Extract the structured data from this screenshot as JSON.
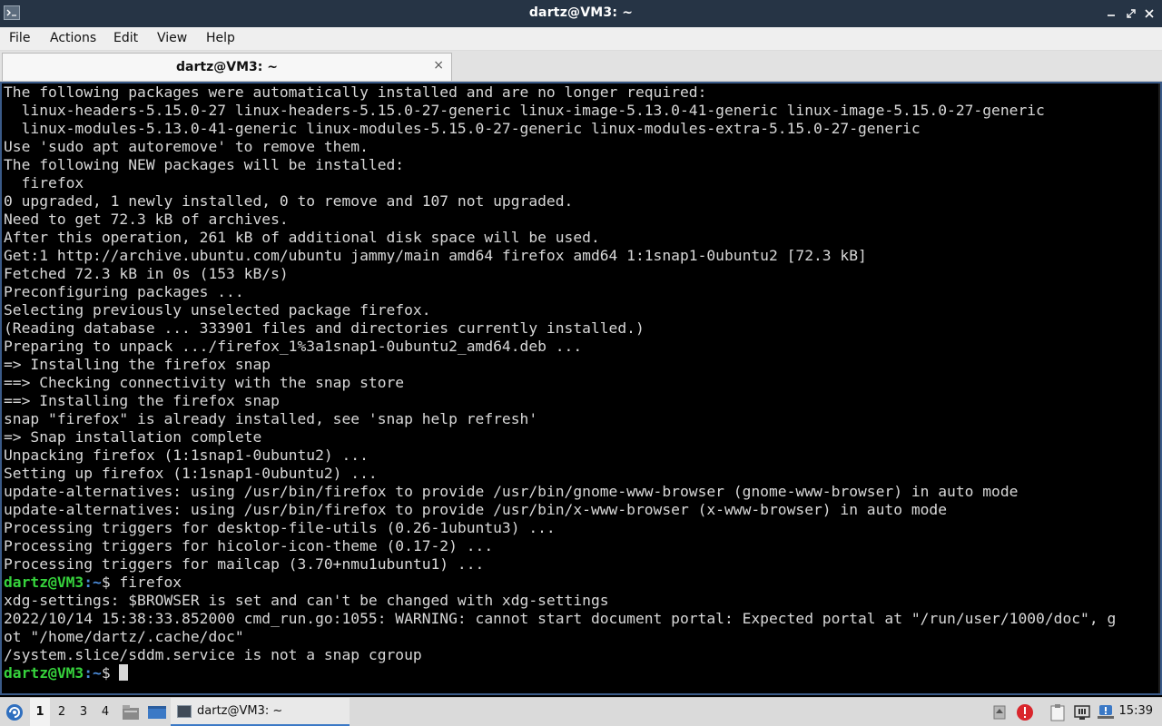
{
  "window": {
    "title": "dartz@VM3: ~"
  },
  "menu": [
    "File",
    "Actions",
    "Edit",
    "View",
    "Help"
  ],
  "tab": {
    "label": "dartz@VM3: ~",
    "close_glyph": "×"
  },
  "terminal": {
    "lines": [
      "The following packages were automatically installed and are no longer required:",
      "  linux-headers-5.15.0-27 linux-headers-5.15.0-27-generic linux-image-5.13.0-41-generic linux-image-5.15.0-27-generic",
      "  linux-modules-5.13.0-41-generic linux-modules-5.15.0-27-generic linux-modules-extra-5.15.0-27-generic",
      "Use 'sudo apt autoremove' to remove them.",
      "The following NEW packages will be installed:",
      "  firefox",
      "0 upgraded, 1 newly installed, 0 to remove and 107 not upgraded.",
      "Need to get 72.3 kB of archives.",
      "After this operation, 261 kB of additional disk space will be used.",
      "Get:1 http://archive.ubuntu.com/ubuntu jammy/main amd64 firefox amd64 1:1snap1-0ubuntu2 [72.3 kB]",
      "Fetched 72.3 kB in 0s (153 kB/s)",
      "Preconfiguring packages ...",
      "Selecting previously unselected package firefox.",
      "(Reading database ... 333901 files and directories currently installed.)",
      "Preparing to unpack .../firefox_1%3a1snap1-0ubuntu2_amd64.deb ...",
      "=> Installing the firefox snap",
      "==> Checking connectivity with the snap store",
      "==> Installing the firefox snap",
      "snap \"firefox\" is already installed, see 'snap help refresh'",
      "=> Snap installation complete",
      "Unpacking firefox (1:1snap1-0ubuntu2) ...",
      "Setting up firefox (1:1snap1-0ubuntu2) ...",
      "update-alternatives: using /usr/bin/firefox to provide /usr/bin/gnome-www-browser (gnome-www-browser) in auto mode",
      "update-alternatives: using /usr/bin/firefox to provide /usr/bin/x-www-browser (x-www-browser) in auto mode",
      "Processing triggers for desktop-file-utils (0.26-1ubuntu3) ...",
      "Processing triggers for hicolor-icon-theme (0.17-2) ...",
      "Processing triggers for mailcap (3.70+nmu1ubuntu1) ..."
    ],
    "prompt_user": "dartz@VM3",
    "prompt_path": ":~",
    "prompt_symbol": "$ ",
    "command": "firefox",
    "output_after": [
      "xdg-settings: $BROWSER is set and can't be changed with xdg-settings",
      "2022/10/14 15:38:33.852000 cmd_run.go:1055: WARNING: cannot start document portal: Expected portal at \"/run/user/1000/doc\", g",
      "ot \"/home/dartz/.cache/doc\"",
      "/system.slice/sddm.service is not a snap cgroup"
    ],
    "cursor": "█"
  },
  "taskbar": {
    "workspaces": [
      "1",
      "2",
      "3",
      "4"
    ],
    "active_workspace": "1",
    "task_label": "dartz@VM3: ~",
    "clock": "15:39"
  },
  "colors": {
    "prompt_user": "#36d23c",
    "prompt_path": "#4b8bd8",
    "titlebar": "#263445",
    "accent": "#3b79c6"
  }
}
